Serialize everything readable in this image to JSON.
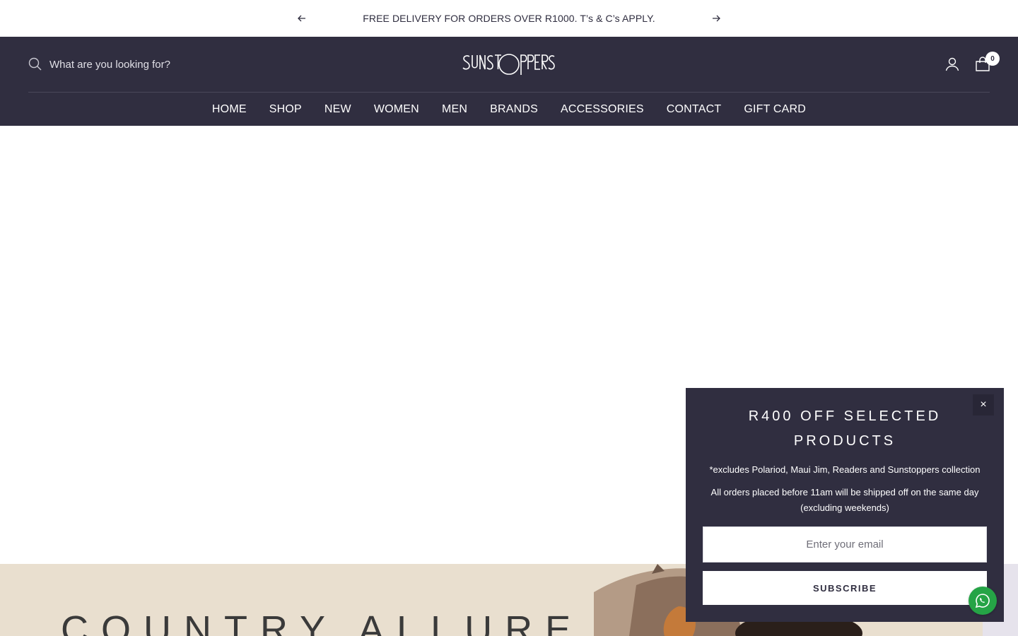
{
  "announcement": {
    "message": "FREE DELIVERY FOR ORDERS OVER R1000. T’s & C’s APPLY."
  },
  "header": {
    "search_placeholder": "What are you looking for?",
    "logo_text": "SUNSTOPPERS",
    "cart_count": "0"
  },
  "nav": {
    "items": [
      {
        "label": "HOME"
      },
      {
        "label": "SHOP"
      },
      {
        "label": "NEW"
      },
      {
        "label": "WOMEN"
      },
      {
        "label": "MEN"
      },
      {
        "label": "BRANDS"
      },
      {
        "label": "ACCESSORIES"
      },
      {
        "label": "CONTACT"
      },
      {
        "label": "GIFT CARD"
      }
    ]
  },
  "hero": {
    "title": "COUNTRY ALLURE"
  },
  "popup": {
    "close_label": "×",
    "title": "R400 OFF SELECTED PRODUCTS",
    "note_excludes": "*excludes Polariod, Maui Jim, Readers and Sunstoppers collection",
    "note_shipping": "All orders placed before 11am will be shipped off on the same day (excluding weekends)",
    "email_placeholder": "Enter your email",
    "subscribe_label": "SUBSCRIBE"
  },
  "colors": {
    "header_bg": "#302e40",
    "hero_bg": "#e9dfcf",
    "whatsapp": "#25a446"
  },
  "icons": {
    "prev": "arrow-left-icon",
    "next": "arrow-right-icon",
    "search": "search-icon",
    "account": "user-icon",
    "cart": "cart-icon",
    "whatsapp": "whatsapp-icon"
  }
}
